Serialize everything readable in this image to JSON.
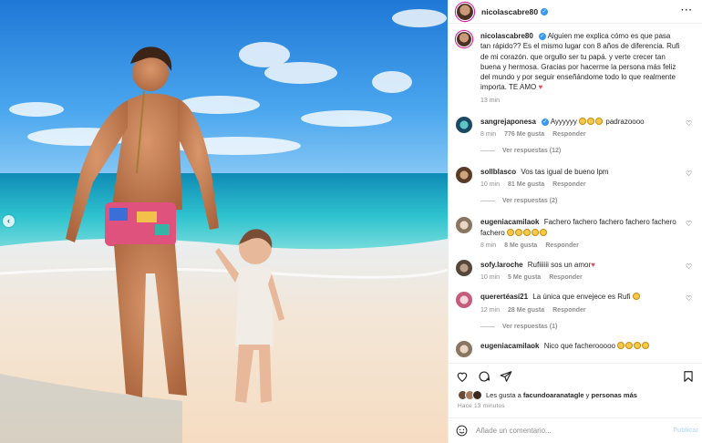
{
  "post": {
    "username": "nicolascabre80",
    "caption_user": "nicolascabre80",
    "caption": "Alguien me explica cómo es que pasa tan rápido?? Es el mismo lugar con 8 años de diferencia. Rufi de mi corazón. que orgullo ser tu papá. y verte crecer tan buena y hermosa. Gracias por hacerme la persona más feliz del mundo y por seguir enseñándome todo lo que realmente importa. TE AMO",
    "caption_time": "13 min"
  },
  "comments": [
    {
      "user": "sangrejaponesa",
      "verified": true,
      "text": "Ayyyyyy",
      "text_after": "padrazoooo",
      "time": "8 min",
      "likes": "776 Me gusta",
      "reply": "Responder",
      "view_replies": "Ver respuestas (12)"
    },
    {
      "user": "sollblasco",
      "verified": false,
      "text": "Vos tas igual de bueno lpm",
      "time": "10 min",
      "likes": "81 Me gusta",
      "reply": "Responder",
      "view_replies": "Ver respuestas (2)"
    },
    {
      "user": "eugeniacamilaok",
      "verified": false,
      "text": "Fachero fachero fachero fachero fachero fachero",
      "time": "8 min",
      "likes": "8 Me gusta",
      "reply": "Responder"
    },
    {
      "user": "sofy.laroche",
      "verified": false,
      "text": "Rufiiiiii sos un amor",
      "time": "10 min",
      "likes": "5 Me gusta",
      "reply": "Responder"
    },
    {
      "user": "querertéasí21",
      "verified": false,
      "text": "La única que envejece es Rufi",
      "time": "12 min",
      "likes": "28 Me gusta",
      "reply": "Responder",
      "view_replies": "Ver respuestas (1)"
    },
    {
      "user": "eugeniacamilaok",
      "verified": false,
      "text": "Nico que facherooooo"
    }
  ],
  "likes_line": {
    "prefix": "Les gusta a",
    "user": "facundoaranatagle",
    "suffix": "y",
    "others": "personas más"
  },
  "posted": "Hace 13 minutos",
  "add_comment": {
    "placeholder": "Añade un comentario...",
    "publish": "Publicar"
  },
  "icons": [
    "more-icon",
    "heart-icon",
    "comment-icon",
    "share-icon",
    "bookmark-icon",
    "emoji-icon",
    "chevron-left-icon",
    "verified-icon"
  ],
  "colors": {
    "verified": "#3897f0",
    "heart": "#ed4956",
    "muted": "#8e8e8e",
    "publish": "#c8dffa"
  }
}
